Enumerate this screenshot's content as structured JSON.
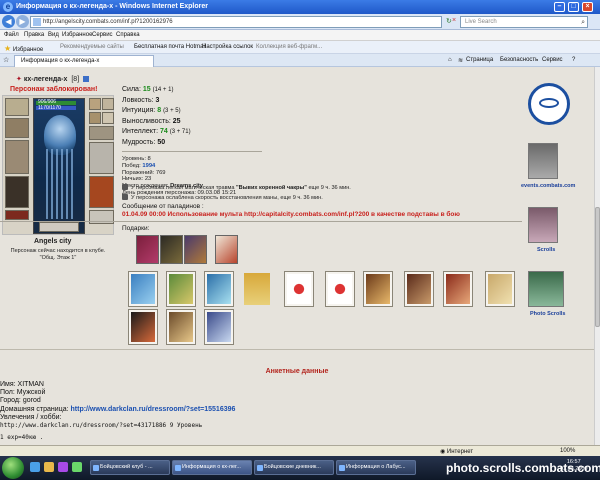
{
  "window": {
    "title": "Информация о кх-легенда-х - Windows Internet Explorer",
    "address": "http://angelscity.combats.com/inf.pl?1200162976",
    "search_placeholder": "Live Search"
  },
  "menu": [
    "Файл",
    "Правка",
    "Вид",
    "Избранное",
    "Сервис",
    "Справка"
  ],
  "favorites_bar": {
    "label": "Избранное",
    "items": [
      "Рекомендуемые сайты",
      "Бесплатная почта Hotmail",
      "Настройка ссылок",
      "Коллекция веб-фрагм..."
    ]
  },
  "tab": {
    "label": "Информация о кх-легенда-х",
    "tools": [
      "Страница",
      "Безопасность",
      "Сервис"
    ]
  },
  "character": {
    "name": "кх-легенда-х",
    "level": "[8]",
    "blocked": "Персонаж заблокирован!",
    "hp": "906/906",
    "mp": "1170/1170"
  },
  "stats": [
    {
      "label": "Сила:",
      "value": "15",
      "bonus": "(14 + 1)",
      "colored": true
    },
    {
      "label": "Ловкость:",
      "value": "3",
      "bonus": "",
      "colored": false
    },
    {
      "label": "Интуиция:",
      "value": "8",
      "bonus": "(3 + 5)",
      "colored": true
    },
    {
      "label": "Выносливость:",
      "value": "25",
      "bonus": "",
      "colored": false
    },
    {
      "label": "Интеллект:",
      "value": "74",
      "bonus": "(3 + 71)",
      "colored": true
    },
    {
      "label": "Мудрость:",
      "value": "50",
      "bonus": "",
      "colored": false
    }
  ],
  "record": {
    "level": "Уровень: 8",
    "wins_label": "Побед:",
    "wins": "1994",
    "losses": "Поражений: 769",
    "draws": "Ничьих: 23",
    "birthplace_label": "Место рождения:",
    "birthplace": "Dreams city",
    "birthday": "День рождения персонажа: 09.03.08 15:21"
  },
  "effects": [
    {
      "text_pre": "У персонажа легкая магическая травма ",
      "bold": "\"Вывих коренной чакры\"",
      "text_post": " еще 9 ч. 36 мин."
    },
    {
      "text_pre": "У персонажа ослаблена скорость восстановления маны, еще 9 ч. 36 мин.",
      "bold": "",
      "text_post": ""
    }
  ],
  "paladin_message": {
    "header": "Сообщение от паладинов :",
    "text": "01.04.09 00:00 Использование мульта http://capitalcity.combats.com/inf.pl?200 в качестве подставы в бою"
  },
  "guild": {
    "name": "Angels city",
    "location": "Персонаж сейчас находится в клубе. \"Общ. Этаж 1\""
  },
  "gifts_label": "Подарки:",
  "right_links": [
    {
      "label": "events.combats.com"
    },
    {
      "label": "Scrolls"
    },
    {
      "label": "Photo Scrolls"
    }
  ],
  "anketa": {
    "header": "Анкетные данные",
    "name": "Имя: XITMAN",
    "gender": "Пол: Мужской",
    "city": "Город: gorod",
    "homepage_label": "Домашняя страница: ",
    "homepage": "http://www.darkclan.ru/dressroom/?set=15516396",
    "hobbies": "Увлечения / хобби:",
    "hobby_line": "http://www.darkclan.ru/dressroom/?set=43171886   9 Уровень",
    "exp_line": "1 exp=40кю ."
  },
  "statusbar": {
    "zone": "Интернет",
    "zoom": "100%"
  },
  "taskbar": {
    "buttons": [
      "Бойцовский клуб - ...",
      "Информация о кх-лег...",
      "Бойцовские дневник...",
      "Информация о Лабус..."
    ],
    "time": "16:57",
    "date": "01.04.2009"
  },
  "watermark": "photo.scrolls.combats.com",
  "colors": {
    "accent": "#1a4fb0",
    "alert": "#c8201c",
    "stat_bonus": "#1a8a1a",
    "page_bg": "#e6e3dc"
  }
}
